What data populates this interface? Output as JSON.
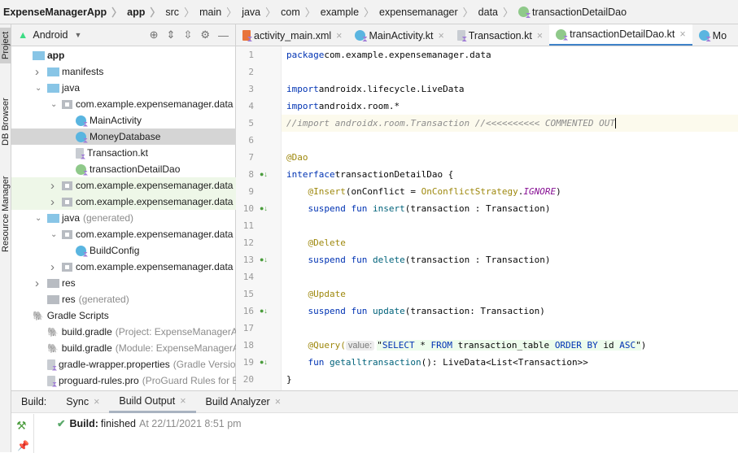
{
  "breadcrumb": [
    "ExpenseManagerApp",
    "app",
    "src",
    "main",
    "java",
    "com",
    "example",
    "expensemanager",
    "data",
    "transactionDetailDao"
  ],
  "left_strip": {
    "project": "Project",
    "db_browser": "DB Browser",
    "resource_manager": "Resource Manager"
  },
  "project_panel": {
    "view_selector": "Android",
    "tree": [
      {
        "label": "app",
        "bold": true,
        "level": 0,
        "arrow": "down",
        "icon": "module"
      },
      {
        "label": "manifests",
        "level": 1,
        "arrow": "right",
        "icon": "folder"
      },
      {
        "label": "java",
        "level": 1,
        "arrow": "down",
        "icon": "folder"
      },
      {
        "label": "com.example.expensemanager.data",
        "level": 2,
        "arrow": "down",
        "icon": "package"
      },
      {
        "label": "MainActivity",
        "level": 3,
        "icon": "class"
      },
      {
        "label": "MoneyDatabase",
        "level": 3,
        "icon": "class",
        "selected": true
      },
      {
        "label": "Transaction.kt",
        "level": 3,
        "icon": "kotlin-file"
      },
      {
        "label": "transactionDetailDao",
        "level": 3,
        "icon": "interface"
      },
      {
        "label": "com.example.expensemanager.data",
        "suffix": "(",
        "level": 2,
        "arrow": "right",
        "icon": "package",
        "green": true
      },
      {
        "label": "com.example.expensemanager.data",
        "suffix": "(",
        "level": 2,
        "arrow": "right",
        "icon": "package",
        "green": true
      },
      {
        "label": "java",
        "suffix": "(generated)",
        "level": 1,
        "arrow": "down",
        "icon": "folder"
      },
      {
        "label": "com.example.expensemanager.data",
        "level": 2,
        "arrow": "down",
        "icon": "package"
      },
      {
        "label": "BuildConfig",
        "level": 3,
        "icon": "class"
      },
      {
        "label": "com.example.expensemanager.data",
        "level": 2,
        "arrow": "right",
        "icon": "package"
      },
      {
        "label": "res",
        "level": 1,
        "arrow": "right",
        "icon": "res-folder"
      },
      {
        "label": "res",
        "suffix": "(generated)",
        "level": 1,
        "icon": "res-folder"
      },
      {
        "label": "Gradle Scripts",
        "level": 0,
        "arrow": "down",
        "icon": "gradle"
      },
      {
        "label": "build.gradle",
        "suffix": "(Project: ExpenseManagerAp",
        "level": 1,
        "icon": "gradle"
      },
      {
        "label": "build.gradle",
        "suffix": "(Module: ExpenseManagerA",
        "level": 1,
        "icon": "gradle"
      },
      {
        "label": "gradle-wrapper.properties",
        "suffix": "(Gradle Versio",
        "level": 1,
        "icon": "properties"
      },
      {
        "label": "proguard-rules.pro",
        "suffix": "(ProGuard Rules for E",
        "level": 1,
        "icon": "file"
      }
    ]
  },
  "tabs": [
    {
      "label": "activity_main.xml",
      "icon": "xml"
    },
    {
      "label": "MainActivity.kt",
      "icon": "class"
    },
    {
      "label": "Transaction.kt",
      "icon": "kotlin-file"
    },
    {
      "label": "transactionDetailDao.kt",
      "icon": "interface",
      "active": true
    },
    {
      "label": "Mo",
      "icon": "class"
    }
  ],
  "editor": {
    "current_line": 5,
    "lines": [
      [
        [
          "kw",
          "package"
        ],
        [
          "",
          "com.example.expensemanager.data"
        ]
      ],
      [],
      [
        [
          "kw",
          "import"
        ],
        [
          "",
          "androidx.lifecycle.LiveData"
        ]
      ],
      [
        [
          "kw",
          "import"
        ],
        [
          "",
          "androidx.room.*"
        ]
      ],
      [
        [
          "cm",
          "//import androidx.room.Transaction //<<<<<<<<<< COMMENTED OUT"
        ]
      ],
      [],
      [
        [
          "an",
          "@Dao"
        ]
      ],
      [
        [
          "kw",
          "interface"
        ],
        [
          "",
          "transactionDetailDao {"
        ]
      ],
      [
        [
          "",
          "    "
        ],
        [
          "an",
          "@Insert"
        ],
        [
          "",
          "(onConflict = "
        ],
        [
          "an",
          "OnConflictStrategy"
        ],
        [
          "",
          "."
        ],
        [
          "it",
          "IGNORE"
        ],
        [
          "",
          ")"
        ]
      ],
      [
        [
          "",
          "    "
        ],
        [
          "kw",
          "suspend fun"
        ],
        [
          "fn",
          " insert"
        ],
        [
          "",
          "(transaction : Transaction)"
        ]
      ],
      [],
      [
        [
          "",
          "    "
        ],
        [
          "an",
          "@Delete"
        ]
      ],
      [
        [
          "",
          "    "
        ],
        [
          "kw",
          "suspend fun"
        ],
        [
          "fn",
          " delete"
        ],
        [
          "",
          "(transaction : Transaction)"
        ]
      ],
      [],
      [
        [
          "",
          "    "
        ],
        [
          "an",
          "@Update"
        ]
      ],
      [
        [
          "",
          "    "
        ],
        [
          "kw",
          "suspend fun"
        ],
        [
          "fn",
          " update"
        ],
        [
          "",
          "(transaction: Transaction)"
        ]
      ],
      [],
      [
        [
          "",
          "    "
        ],
        [
          "an",
          "@Query("
        ],
        [
          "hint",
          "value:"
        ],
        [
          "sqs",
          "\"SELECT * FROM transaction_table ORDER BY id ASC\""
        ],
        [
          "",
          ")"
        ]
      ],
      [
        [
          "",
          "    "
        ],
        [
          "kw",
          "fun"
        ],
        [
          "fn",
          " getalltransaction"
        ],
        [
          "",
          "(): LiveData<List<Transaction>>"
        ]
      ],
      [
        [
          "",
          "}"
        ]
      ]
    ],
    "impl_marker_lines": [
      8,
      10,
      13,
      16,
      19
    ]
  },
  "build_panel": {
    "label": "Build:",
    "tabs": [
      {
        "label": "Sync"
      },
      {
        "label": "Build Output",
        "active": true
      },
      {
        "label": "Build Analyzer"
      }
    ],
    "message": {
      "title": "Build:",
      "status": "finished",
      "time": "At 22/11/2021 8:51 pm"
    }
  },
  "colors": {
    "accent": "#4083c9",
    "success": "#59a869",
    "keyword": "#0033b3",
    "annotation": "#9e880d"
  }
}
